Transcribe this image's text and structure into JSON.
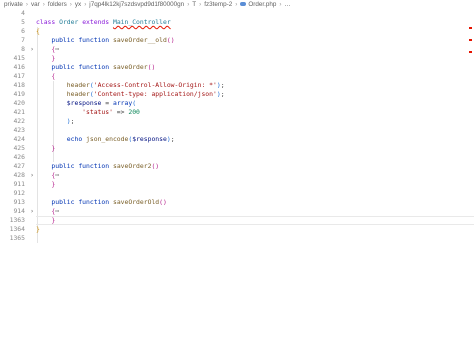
{
  "breadcrumb": {
    "items": [
      "private",
      "var",
      "folders",
      "yx",
      "j7qp4lk12kj7szdsvpd9d1f80000gn",
      "T",
      "fz3temp-2"
    ],
    "file": "Order.php",
    "more": "…"
  },
  "editor": {
    "lines": [
      {
        "num": "4",
        "fold": "",
        "tokens": []
      },
      {
        "num": "5",
        "fold": "",
        "tokens": [
          {
            "t": "class ",
            "c": "kw"
          },
          {
            "t": "Order ",
            "c": "cls"
          },
          {
            "t": "extends ",
            "c": "kw"
          },
          {
            "t": "Main_Controller",
            "c": "cls squig"
          }
        ]
      },
      {
        "num": "6",
        "fold": "",
        "tokens": [
          {
            "t": "{",
            "c": "br1"
          }
        ]
      },
      {
        "num": "7",
        "fold": "",
        "tokens": [
          {
            "t": "    public ",
            "c": "kwb"
          },
          {
            "t": "function ",
            "c": "kwb"
          },
          {
            "t": "saveOrder__old",
            "c": "fnc"
          },
          {
            "t": "()",
            "c": "br2"
          }
        ]
      },
      {
        "num": "8",
        "fold": "›",
        "tokens": [
          {
            "t": "    ",
            "c": ""
          },
          {
            "t": "{",
            "c": "br2"
          },
          {
            "t": "⋯",
            "c": ""
          }
        ]
      },
      {
        "num": "415",
        "fold": "",
        "tokens": [
          {
            "t": "    ",
            "c": ""
          },
          {
            "t": "}",
            "c": "br2"
          }
        ]
      },
      {
        "num": "416",
        "fold": "",
        "tokens": [
          {
            "t": "    public ",
            "c": "kwb"
          },
          {
            "t": "function ",
            "c": "kwb"
          },
          {
            "t": "saveOrder",
            "c": "fnc"
          },
          {
            "t": "()",
            "c": "br2"
          }
        ]
      },
      {
        "num": "417",
        "fold": "",
        "tokens": [
          {
            "t": "    ",
            "c": ""
          },
          {
            "t": "{",
            "c": "br2"
          }
        ]
      },
      {
        "num": "418",
        "fold": "",
        "tokens": [
          {
            "t": "        ",
            "c": ""
          },
          {
            "t": "header",
            "c": "fnc"
          },
          {
            "t": "(",
            "c": "br3"
          },
          {
            "t": "'Access-Control-Allow-Origin: *'",
            "c": "str"
          },
          {
            "t": ")",
            "c": "br3"
          },
          {
            "t": ";",
            "c": ""
          }
        ]
      },
      {
        "num": "419",
        "fold": "",
        "tokens": [
          {
            "t": "        ",
            "c": ""
          },
          {
            "t": "header",
            "c": "fnc"
          },
          {
            "t": "(",
            "c": "br3"
          },
          {
            "t": "'Content-type: application/json'",
            "c": "str"
          },
          {
            "t": ")",
            "c": "br3"
          },
          {
            "t": ";",
            "c": ""
          }
        ]
      },
      {
        "num": "420",
        "fold": "",
        "tokens": [
          {
            "t": "        ",
            "c": ""
          },
          {
            "t": "$response",
            "c": "var"
          },
          {
            "t": " = ",
            "c": ""
          },
          {
            "t": "array",
            "c": "kwb"
          },
          {
            "t": "(",
            "c": "br3"
          }
        ]
      },
      {
        "num": "421",
        "fold": "",
        "tokens": [
          {
            "t": "            ",
            "c": ""
          },
          {
            "t": "'status'",
            "c": "str"
          },
          {
            "t": " => ",
            "c": ""
          },
          {
            "t": "200",
            "c": "num"
          }
        ]
      },
      {
        "num": "422",
        "fold": "",
        "tokens": [
          {
            "t": "        ",
            "c": ""
          },
          {
            "t": ")",
            "c": "br3"
          },
          {
            "t": ";",
            "c": ""
          }
        ]
      },
      {
        "num": "423",
        "fold": "",
        "tokens": []
      },
      {
        "num": "424",
        "fold": "",
        "tokens": [
          {
            "t": "        ",
            "c": ""
          },
          {
            "t": "echo ",
            "c": "kwb"
          },
          {
            "t": "json_encode",
            "c": "fnc"
          },
          {
            "t": "(",
            "c": "br3"
          },
          {
            "t": "$response",
            "c": "var"
          },
          {
            "t": ")",
            "c": "br3"
          },
          {
            "t": ";",
            "c": ""
          }
        ]
      },
      {
        "num": "425",
        "fold": "",
        "tokens": [
          {
            "t": "    ",
            "c": ""
          },
          {
            "t": "}",
            "c": "br2"
          }
        ]
      },
      {
        "num": "426",
        "fold": "",
        "tokens": []
      },
      {
        "num": "427",
        "fold": "",
        "tokens": [
          {
            "t": "    public ",
            "c": "kwb"
          },
          {
            "t": "function ",
            "c": "kwb"
          },
          {
            "t": "saveOrder2",
            "c": "fnc"
          },
          {
            "t": "()",
            "c": "br2"
          }
        ]
      },
      {
        "num": "428",
        "fold": "›",
        "tokens": [
          {
            "t": "    ",
            "c": ""
          },
          {
            "t": "{",
            "c": "br2"
          },
          {
            "t": "⋯",
            "c": ""
          }
        ]
      },
      {
        "num": "911",
        "fold": "",
        "tokens": [
          {
            "t": "    ",
            "c": ""
          },
          {
            "t": "}",
            "c": "br2"
          }
        ]
      },
      {
        "num": "912",
        "fold": "",
        "tokens": []
      },
      {
        "num": "913",
        "fold": "",
        "tokens": [
          {
            "t": "    public ",
            "c": "kwb"
          },
          {
            "t": "function ",
            "c": "kwb"
          },
          {
            "t": "saveOrderOld",
            "c": "fnc"
          },
          {
            "t": "()",
            "c": "br2"
          }
        ]
      },
      {
        "num": "914",
        "fold": "›",
        "tokens": [
          {
            "t": "    ",
            "c": ""
          },
          {
            "t": "{",
            "c": "br2"
          },
          {
            "t": "⋯",
            "c": ""
          }
        ]
      },
      {
        "num": "1363",
        "fold": "",
        "tokens": [
          {
            "t": "    ",
            "c": ""
          },
          {
            "t": "}",
            "c": "br2"
          }
        ]
      },
      {
        "num": "1364",
        "fold": "",
        "tokens": [
          {
            "t": "}",
            "c": "br1"
          }
        ]
      },
      {
        "num": "1365",
        "fold": "",
        "tokens": []
      }
    ]
  },
  "colors": {
    "keyword": "#0033b3",
    "string": "#a31515",
    "function": "#795e26",
    "error_squiggle": "#e51400"
  }
}
